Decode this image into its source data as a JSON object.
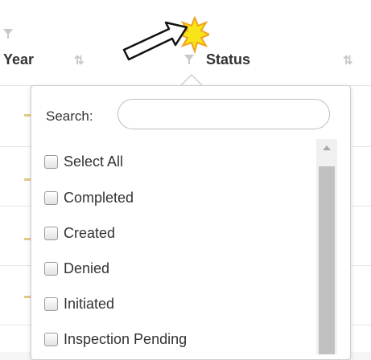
{
  "table": {
    "columns": [
      {
        "title": "Year"
      },
      {
        "title": "Status"
      }
    ]
  },
  "filter": {
    "search_label": "Search:",
    "search_value": "",
    "options": [
      {
        "label": "Select All",
        "checked": false
      },
      {
        "label": "Completed",
        "checked": false
      },
      {
        "label": "Created",
        "checked": false
      },
      {
        "label": "Denied",
        "checked": false
      },
      {
        "label": "Initiated",
        "checked": false
      },
      {
        "label": "Inspection Pending",
        "checked": false
      }
    ]
  },
  "icons": {
    "sort": "sort-arrows-icon",
    "filter": "funnel-icon",
    "annotation": "pointer-arrow-starburst"
  },
  "colors": {
    "accent_yellow": "#f7e51a",
    "starburst_orange": "#f2a31b"
  }
}
